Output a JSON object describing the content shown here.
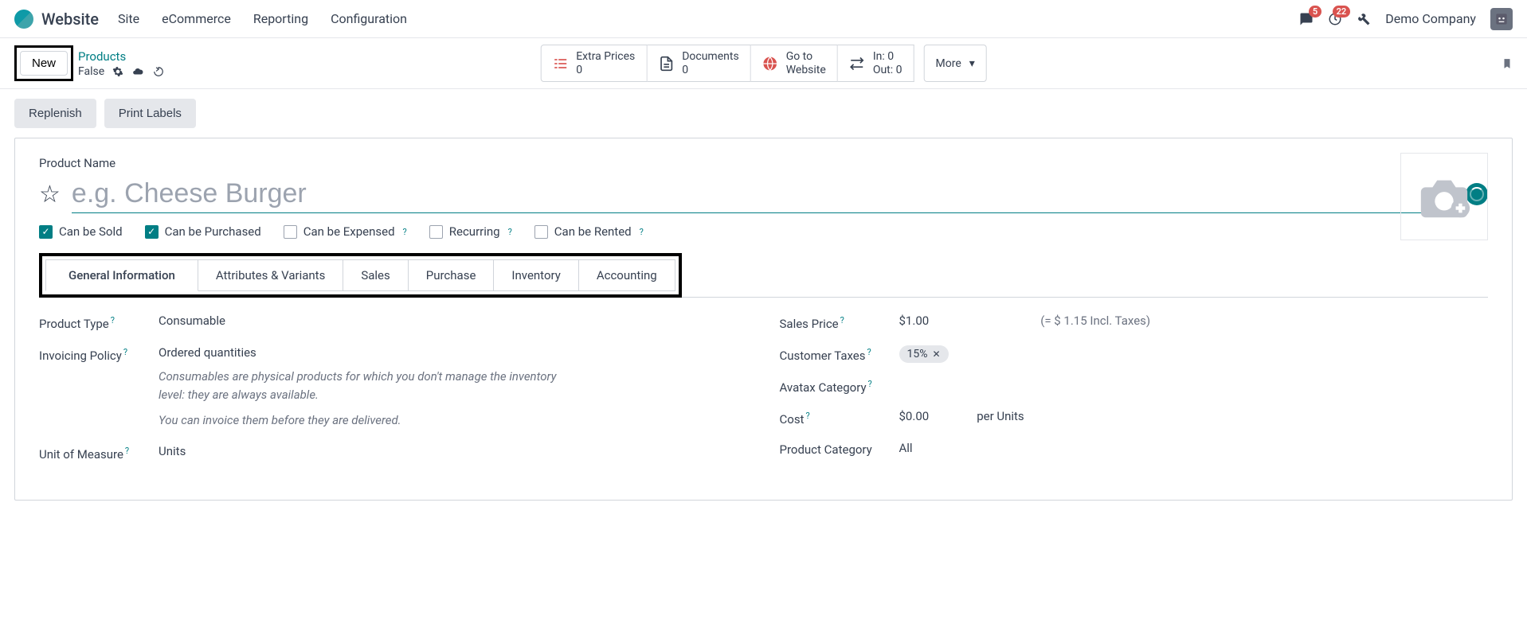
{
  "nav": {
    "app": "Website",
    "items": [
      "Site",
      "eCommerce",
      "Reporting",
      "Configuration"
    ],
    "msg_badge": "5",
    "act_badge": "22",
    "company": "Demo Company"
  },
  "breadcrumb": {
    "new": "New",
    "link": "Products",
    "sub": "False"
  },
  "stats": {
    "extra_prices_label": "Extra Prices",
    "extra_prices_val": "0",
    "documents_label": "Documents",
    "documents_val": "0",
    "website_l1": "Go to",
    "website_l2": "Website",
    "in_label": "In: 0",
    "out_label": "Out: 0",
    "more": "More"
  },
  "actions": {
    "replenish": "Replenish",
    "print": "Print Labels"
  },
  "form": {
    "name_label": "Product Name",
    "name_placeholder": "e.g. Cheese Burger",
    "chk_sold": "Can be Sold",
    "chk_purchased": "Can be Purchased",
    "chk_expensed": "Can be Expensed",
    "chk_recurring": "Recurring",
    "chk_rented": "Can be Rented"
  },
  "tabs": [
    "General Information",
    "Attributes & Variants",
    "Sales",
    "Purchase",
    "Inventory",
    "Accounting"
  ],
  "fields": {
    "product_type_l": "Product Type",
    "product_type_v": "Consumable",
    "invoicing_l": "Invoicing Policy",
    "invoicing_v": "Ordered quantities",
    "hint1": "Consumables are physical products for which you don't manage the inventory level: they are always available.",
    "hint2": "You can invoice them before they are delivered.",
    "uom_l": "Unit of Measure",
    "uom_v": "Units",
    "sales_price_l": "Sales Price",
    "sales_price_v": "$1.00",
    "sales_price_note": "(= $ 1.15 Incl. Taxes)",
    "cust_tax_l": "Customer Taxes",
    "cust_tax_v": "15%",
    "avatax_l": "Avatax Category",
    "cost_l": "Cost",
    "cost_v": "$0.00",
    "cost_unit": "per Units",
    "cat_l": "Product Category",
    "cat_v": "All"
  }
}
